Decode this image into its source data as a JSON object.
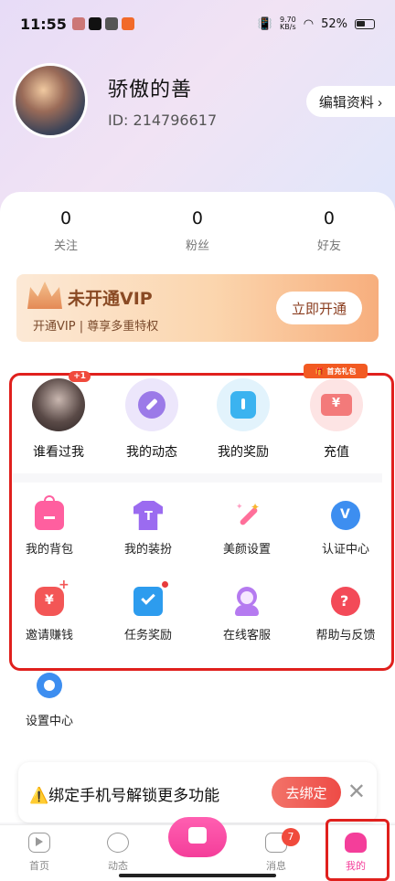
{
  "status_bar": {
    "time": "11:55",
    "net_speed": "9.70\nKB/s",
    "battery": "52%"
  },
  "profile": {
    "name": "骄傲的善",
    "id_label": "ID: 214796617",
    "edit_label": "编辑资料 ›"
  },
  "stats": [
    {
      "value": "0",
      "label": "关注"
    },
    {
      "value": "0",
      "label": "粉丝"
    },
    {
      "value": "0",
      "label": "好友"
    }
  ],
  "vip": {
    "title": "未开通VIP",
    "subtitle": "开通VIP | 尊享多重特权",
    "button": "立即开通"
  },
  "top_features": [
    {
      "label": "谁看过我",
      "badge": "+1",
      "icon": "avatar-photo"
    },
    {
      "label": "我的动态",
      "icon": "compass-icon"
    },
    {
      "label": "我的奖励",
      "icon": "gift-box-icon"
    },
    {
      "label": "充值",
      "icon": "recharge-ticket-icon",
      "tag": "🎁 首充礼包"
    }
  ],
  "grid_row1": [
    {
      "label": "我的背包",
      "icon": "backpack-icon"
    },
    {
      "label": "我的装扮",
      "icon": "tshirt-icon"
    },
    {
      "label": "美颜设置",
      "icon": "magic-wand-icon"
    },
    {
      "label": "认证中心",
      "icon": "verified-badge-icon"
    }
  ],
  "grid_row2": [
    {
      "label": "邀请赚钱",
      "icon": "money-bag-icon"
    },
    {
      "label": "任务奖励",
      "icon": "checkbox-icon",
      "has_dot": true
    },
    {
      "label": "在线客服",
      "icon": "customer-service-icon"
    },
    {
      "label": "帮助与反馈",
      "icon": "help-icon"
    }
  ],
  "settings": {
    "label": "设置中心",
    "icon": "gear-icon"
  },
  "notice": {
    "text": "⚠️绑定手机号解锁更多功能",
    "button": "去绑定",
    "close": "✕"
  },
  "bottom_nav": [
    {
      "label": "首页",
      "icon": "play-icon"
    },
    {
      "label": "动态",
      "icon": "compass-icon"
    },
    {
      "label": "",
      "icon": "tv-icon"
    },
    {
      "label": "消息",
      "icon": "chat-icon",
      "badge": "7"
    },
    {
      "label": "我的",
      "icon": "profile-icon",
      "active": true
    }
  ],
  "colors": {
    "accent": "#f43e9a",
    "highlight": "#e0201d"
  }
}
